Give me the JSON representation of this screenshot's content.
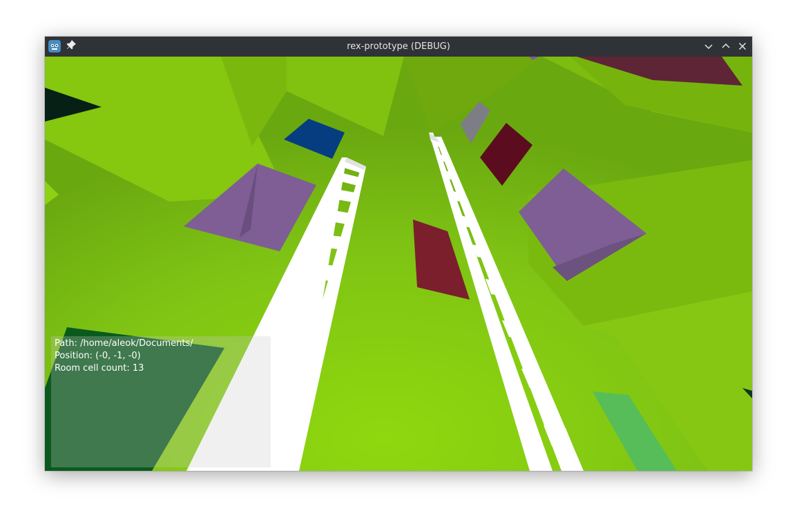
{
  "window": {
    "title": "rex-prototype (DEBUG)",
    "app_icon": "godot-engine-icon",
    "controls": [
      "minimize",
      "maximize",
      "close"
    ]
  },
  "hud": {
    "path_line": "Path: /home/aleok/Documents/",
    "position_line": "Position: (-0, -1, -0)",
    "room_line": "Room cell count: 13"
  },
  "colors": {
    "titlebar": "#2f3237",
    "scene_green": "#7fc414",
    "ladder": "#ffffff",
    "purple_block": "#7e5e95",
    "red_block": "#7b1f2c",
    "blue_block": "#053d80",
    "dark_green_block": "#0a5a1e"
  }
}
